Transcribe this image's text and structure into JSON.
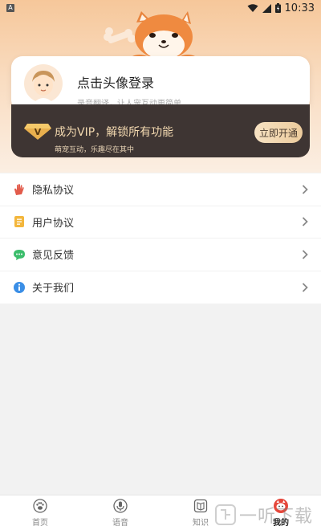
{
  "status_bar": {
    "notification_glyph": "A",
    "time": "10:33"
  },
  "profile": {
    "login_title": "点击头像登录",
    "login_subtitle": "录音翻译，让人宠互动更简单"
  },
  "vip": {
    "badge_letter": "V",
    "title": "成为VIP，解锁所有功能",
    "subtitle": "萌宠互动，乐趣尽在其中",
    "button_label": "立即开通"
  },
  "menu": {
    "items": [
      {
        "label": "隐私协议",
        "icon": "hand-icon"
      },
      {
        "label": "用户协议",
        "icon": "document-icon"
      },
      {
        "label": "意见反馈",
        "icon": "chat-bubble-icon"
      },
      {
        "label": "关于我们",
        "icon": "info-icon"
      }
    ]
  },
  "tabs": [
    {
      "label": "首页",
      "icon": "paw-icon",
      "active": false
    },
    {
      "label": "语音",
      "icon": "microphone-icon",
      "active": false
    },
    {
      "label": "知识",
      "icon": "book-icon",
      "active": false
    },
    {
      "label": "我的",
      "icon": "dog-profile-icon",
      "active": true
    }
  ],
  "colors": {
    "header_gradient_top": "#f6c79a",
    "vip_card_bg": "#3e3533",
    "vip_text": "#f3d9b0",
    "page_bg": "#f2f2f2"
  },
  "watermark": {
    "text": "一听下载"
  }
}
